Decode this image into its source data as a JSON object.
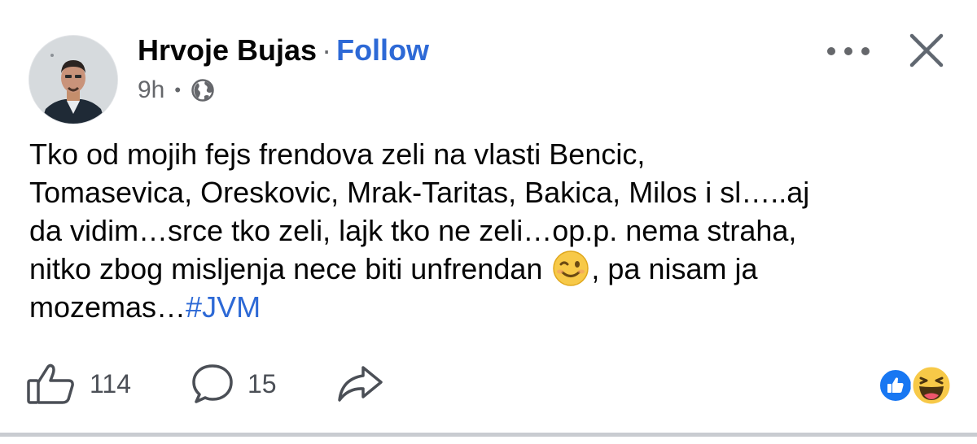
{
  "post": {
    "author": "Hrvoje Bujas",
    "separator": "·",
    "follow_label": "Follow",
    "time": "9h",
    "meta_separator": "•",
    "audience_icon": "globe-icon",
    "text_lines": [
      "Tko od mojih fejs frendova zeli na vlasti Bencic,",
      "Tomasevica, Oreskovic, Mrak-Taritas, Bakica, Milos i sl…..aj",
      "da vidim…srce tko zeli, lajk tko ne zeli…op.p. nema straha,"
    ],
    "line4_before_emoji": "nitko zbog misljenja nece biti unfrendan ",
    "emoji": "wink-emoji",
    "line4_after_emoji": ", pa nisam ja",
    "line5_text": "mozemas…",
    "hashtag": "#JVM"
  },
  "actions": {
    "like_count": "114",
    "comment_count": "15"
  },
  "reactions": [
    "like",
    "haha"
  ],
  "colors": {
    "link_blue": "#2d69d6",
    "meta_gray": "#65676b",
    "reaction_blue": "#1877f2",
    "haha_yellow": "#f7c948"
  }
}
